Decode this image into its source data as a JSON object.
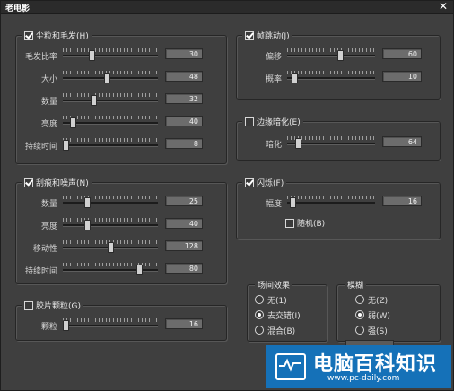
{
  "window": {
    "title": "老电影",
    "close": "✕"
  },
  "dust": {
    "title": "尘粒和毛发(H)",
    "enabled": true,
    "rows": [
      {
        "label": "毛发比率",
        "value": "30",
        "level": 0.3
      },
      {
        "label": "大小",
        "value": "48",
        "level": 0.46
      },
      {
        "label": "数量",
        "value": "32",
        "level": 0.32
      },
      {
        "label": "亮度",
        "value": "40",
        "level": 0.1
      },
      {
        "label": "持续时间",
        "value": "8",
        "level": 0.03
      }
    ]
  },
  "jitter": {
    "title": "帧跳动(J)",
    "enabled": true,
    "rows": [
      {
        "label": "偏移",
        "value": "60",
        "level": 0.6
      },
      {
        "label": "概率",
        "value": "10",
        "level": 0.08
      }
    ]
  },
  "vignette": {
    "title": "边缘暗化(E)",
    "enabled": false,
    "rows": [
      {
        "label": "暗化",
        "value": "64",
        "level": 0.12
      }
    ]
  },
  "scratch": {
    "title": "刮痕和噪声(N)",
    "enabled": true,
    "rows": [
      {
        "label": "数量",
        "value": "25",
        "level": 0.25
      },
      {
        "label": "亮度",
        "value": "40",
        "level": 0.25
      },
      {
        "label": "移动性",
        "value": "128",
        "level": 0.5
      },
      {
        "label": "持续时间",
        "value": "80",
        "level": 0.8
      }
    ]
  },
  "flicker": {
    "title": "闪烁(F)",
    "enabled": true,
    "rows": [
      {
        "label": "幅度",
        "value": "16",
        "level": 0.06
      }
    ],
    "random_label": "随机(B)",
    "random_checked": false
  },
  "grain": {
    "title": "胶片颗粒(G)",
    "enabled": false,
    "rows": [
      {
        "label": "颗粒",
        "value": "16",
        "level": 0.03
      }
    ]
  },
  "transition": {
    "title": "场间效果",
    "options": [
      {
        "label": "无(1)",
        "selected": false
      },
      {
        "label": "去交错(I)",
        "selected": true
      },
      {
        "label": "混合(B)",
        "selected": false
      }
    ]
  },
  "blur": {
    "title": "模糊",
    "options": [
      {
        "label": "无(Z)",
        "selected": false
      },
      {
        "label": "弱(W)",
        "selected": true
      },
      {
        "label": "强(S)",
        "selected": false
      }
    ]
  },
  "watermark": {
    "title": "电脑百科知识",
    "url": "www.pc-daily.com"
  }
}
